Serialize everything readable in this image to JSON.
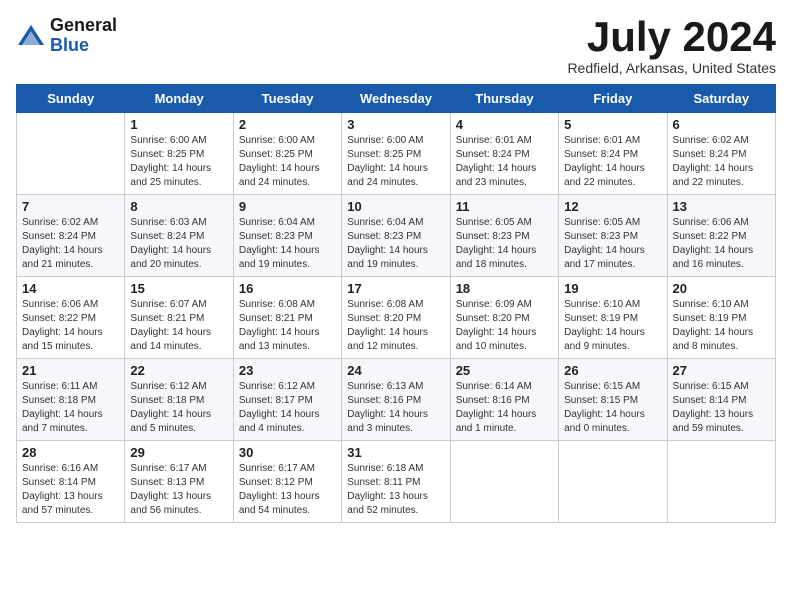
{
  "header": {
    "logo_general": "General",
    "logo_blue": "Blue",
    "month_year": "July 2024",
    "location": "Redfield, Arkansas, United States"
  },
  "weekdays": [
    "Sunday",
    "Monday",
    "Tuesday",
    "Wednesday",
    "Thursday",
    "Friday",
    "Saturday"
  ],
  "weeks": [
    [
      {
        "day": "",
        "info": ""
      },
      {
        "day": "1",
        "info": "Sunrise: 6:00 AM\nSunset: 8:25 PM\nDaylight: 14 hours\nand 25 minutes."
      },
      {
        "day": "2",
        "info": "Sunrise: 6:00 AM\nSunset: 8:25 PM\nDaylight: 14 hours\nand 24 minutes."
      },
      {
        "day": "3",
        "info": "Sunrise: 6:00 AM\nSunset: 8:25 PM\nDaylight: 14 hours\nand 24 minutes."
      },
      {
        "day": "4",
        "info": "Sunrise: 6:01 AM\nSunset: 8:24 PM\nDaylight: 14 hours\nand 23 minutes."
      },
      {
        "day": "5",
        "info": "Sunrise: 6:01 AM\nSunset: 8:24 PM\nDaylight: 14 hours\nand 22 minutes."
      },
      {
        "day": "6",
        "info": "Sunrise: 6:02 AM\nSunset: 8:24 PM\nDaylight: 14 hours\nand 22 minutes."
      }
    ],
    [
      {
        "day": "7",
        "info": "Sunrise: 6:02 AM\nSunset: 8:24 PM\nDaylight: 14 hours\nand 21 minutes."
      },
      {
        "day": "8",
        "info": "Sunrise: 6:03 AM\nSunset: 8:24 PM\nDaylight: 14 hours\nand 20 minutes."
      },
      {
        "day": "9",
        "info": "Sunrise: 6:04 AM\nSunset: 8:23 PM\nDaylight: 14 hours\nand 19 minutes."
      },
      {
        "day": "10",
        "info": "Sunrise: 6:04 AM\nSunset: 8:23 PM\nDaylight: 14 hours\nand 19 minutes."
      },
      {
        "day": "11",
        "info": "Sunrise: 6:05 AM\nSunset: 8:23 PM\nDaylight: 14 hours\nand 18 minutes."
      },
      {
        "day": "12",
        "info": "Sunrise: 6:05 AM\nSunset: 8:23 PM\nDaylight: 14 hours\nand 17 minutes."
      },
      {
        "day": "13",
        "info": "Sunrise: 6:06 AM\nSunset: 8:22 PM\nDaylight: 14 hours\nand 16 minutes."
      }
    ],
    [
      {
        "day": "14",
        "info": "Sunrise: 6:06 AM\nSunset: 8:22 PM\nDaylight: 14 hours\nand 15 minutes."
      },
      {
        "day": "15",
        "info": "Sunrise: 6:07 AM\nSunset: 8:21 PM\nDaylight: 14 hours\nand 14 minutes."
      },
      {
        "day": "16",
        "info": "Sunrise: 6:08 AM\nSunset: 8:21 PM\nDaylight: 14 hours\nand 13 minutes."
      },
      {
        "day": "17",
        "info": "Sunrise: 6:08 AM\nSunset: 8:20 PM\nDaylight: 14 hours\nand 12 minutes."
      },
      {
        "day": "18",
        "info": "Sunrise: 6:09 AM\nSunset: 8:20 PM\nDaylight: 14 hours\nand 10 minutes."
      },
      {
        "day": "19",
        "info": "Sunrise: 6:10 AM\nSunset: 8:19 PM\nDaylight: 14 hours\nand 9 minutes."
      },
      {
        "day": "20",
        "info": "Sunrise: 6:10 AM\nSunset: 8:19 PM\nDaylight: 14 hours\nand 8 minutes."
      }
    ],
    [
      {
        "day": "21",
        "info": "Sunrise: 6:11 AM\nSunset: 8:18 PM\nDaylight: 14 hours\nand 7 minutes."
      },
      {
        "day": "22",
        "info": "Sunrise: 6:12 AM\nSunset: 8:18 PM\nDaylight: 14 hours\nand 5 minutes."
      },
      {
        "day": "23",
        "info": "Sunrise: 6:12 AM\nSunset: 8:17 PM\nDaylight: 14 hours\nand 4 minutes."
      },
      {
        "day": "24",
        "info": "Sunrise: 6:13 AM\nSunset: 8:16 PM\nDaylight: 14 hours\nand 3 minutes."
      },
      {
        "day": "25",
        "info": "Sunrise: 6:14 AM\nSunset: 8:16 PM\nDaylight: 14 hours\nand 1 minute."
      },
      {
        "day": "26",
        "info": "Sunrise: 6:15 AM\nSunset: 8:15 PM\nDaylight: 14 hours\nand 0 minutes."
      },
      {
        "day": "27",
        "info": "Sunrise: 6:15 AM\nSunset: 8:14 PM\nDaylight: 13 hours\nand 59 minutes."
      }
    ],
    [
      {
        "day": "28",
        "info": "Sunrise: 6:16 AM\nSunset: 8:14 PM\nDaylight: 13 hours\nand 57 minutes."
      },
      {
        "day": "29",
        "info": "Sunrise: 6:17 AM\nSunset: 8:13 PM\nDaylight: 13 hours\nand 56 minutes."
      },
      {
        "day": "30",
        "info": "Sunrise: 6:17 AM\nSunset: 8:12 PM\nDaylight: 13 hours\nand 54 minutes."
      },
      {
        "day": "31",
        "info": "Sunrise: 6:18 AM\nSunset: 8:11 PM\nDaylight: 13 hours\nand 52 minutes."
      },
      {
        "day": "",
        "info": ""
      },
      {
        "day": "",
        "info": ""
      },
      {
        "day": "",
        "info": ""
      }
    ]
  ]
}
